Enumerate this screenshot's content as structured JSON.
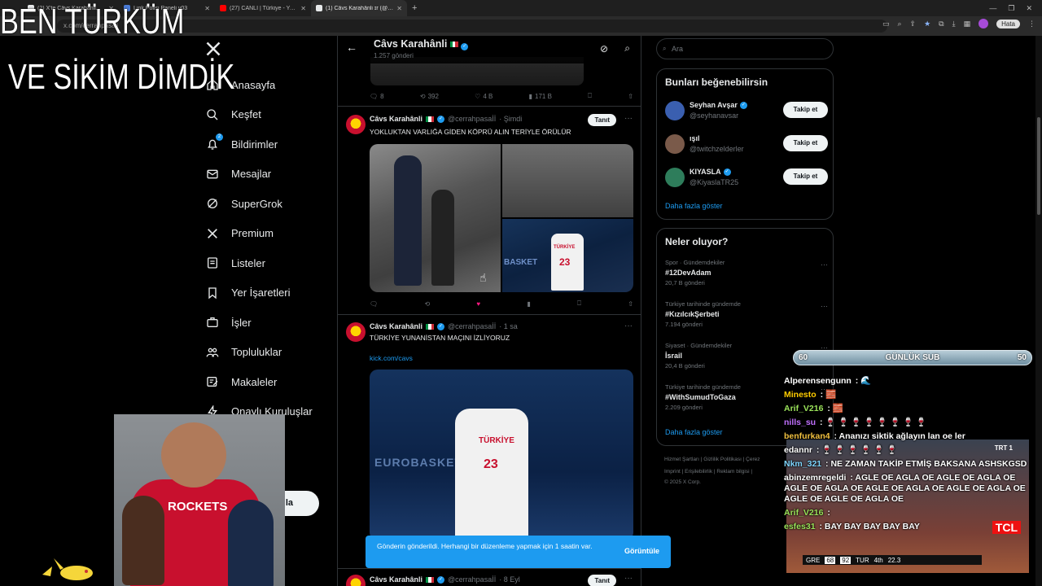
{
  "browser": {
    "tabs": [
      {
        "title": "(2) X'te Câvs Karahânli...",
        "color": "#e7e9ea",
        "active": false
      },
      {
        "title": "Link Polisi Paneli v03",
        "color": "#4a7bd6",
        "active": false
      },
      {
        "title": "(27) CANLI | Türkiye - Yunan",
        "color": "#ff0000",
        "active": false
      },
      {
        "title": "(1) Câvs Karahânli ɪr (@cerrah",
        "color": "#e7e9ea",
        "active": true
      }
    ],
    "url": "x.com/cerrahpasaii",
    "error_label": "Hata"
  },
  "sidebar": {
    "items": [
      {
        "label": "Anasayfa",
        "icon": "home-icon"
      },
      {
        "label": "Keşfet",
        "icon": "search-icon"
      },
      {
        "label": "Bildirimler",
        "icon": "bell-icon",
        "badge": "2"
      },
      {
        "label": "Mesajlar",
        "icon": "mail-icon"
      },
      {
        "label": "SuperGrok",
        "icon": "grok-icon"
      },
      {
        "label": "Premium",
        "icon": "x-icon"
      },
      {
        "label": "Listeler",
        "icon": "list-icon"
      },
      {
        "label": "Yer İşaretleri",
        "icon": "bookmark-icon"
      },
      {
        "label": "İşler",
        "icon": "briefcase-icon"
      },
      {
        "label": "Topluluklar",
        "icon": "people-icon"
      },
      {
        "label": "Makaleler",
        "icon": "article-icon"
      },
      {
        "label": "Onaylı Kuruluşlar",
        "icon": "lightning-icon"
      }
    ],
    "post_button": "la"
  },
  "profile_header": {
    "name": "Câvs Karahânli",
    "post_count": "1.257 gönderi"
  },
  "prev_tweet_actions": {
    "replies": "8",
    "reposts": "392",
    "likes": "4 B",
    "views": "171 B"
  },
  "tweets": [
    {
      "name": "Câvs Karahânli",
      "handle": "@cerrahpasaİİ",
      "time": "· Şimdi",
      "text": "YOKLUKTAN VARLIĞA GİDEN KÖPRÜ ALIN TERİYLE ÖRÜLÜR",
      "follow": "Tanıt",
      "media_labels": {
        "team": "TÜRKİYE",
        "number": "23",
        "court": "BASKET"
      }
    },
    {
      "name": "Câvs Karahânli",
      "handle": "@cerrahpasaİİ",
      "time": "· 1 sa",
      "text": "TÜRKİYE YUNANİSTAN MAÇINI İZLİYORUZ",
      "link": "kick.com/cavs",
      "media_labels": {
        "team": "TÜRKİYE",
        "number": "23",
        "court": "EUROBASKET"
      }
    },
    {
      "name": "Câvs Karahânli",
      "handle": "@cerrahpasaİİ",
      "time": "· 8 Eyl",
      "follow": "Tanıt"
    }
  ],
  "toast": {
    "text": "Gönderin gönderildi. Herhangi bir düzenleme yapmak için 1 saatin var.",
    "button": "Görüntüle"
  },
  "right": {
    "search_placeholder": "Ara",
    "suggest_title": "Bunları beğenebilirsin",
    "suggestions": [
      {
        "name": "Seyhan Avşar",
        "handle": "@seyhanavsar",
        "verified": true,
        "follow": "Takip et",
        "avatar_color": "#3a5fb0"
      },
      {
        "name": "ışıl",
        "handle": "@twitchzelderler",
        "verified": false,
        "follow": "Takip et",
        "avatar_color": "#7a5a4a"
      },
      {
        "name": "KIYASLA",
        "handle": "@KiyaslaTR25",
        "verified": true,
        "follow": "Takip et",
        "avatar_color": "#2e7d5b"
      }
    ],
    "show_more": "Daha fazla göster",
    "trends_title": "Neler oluyor?",
    "trends": [
      {
        "category": "Spor · Gündemdekiler",
        "tag": "#12DevAdam",
        "count": "20,7 B gönderi"
      },
      {
        "category": "Türkiye tarihinde gündemde",
        "tag": "#KızılcıkŞerbeti",
        "count": "7.194 gönderi"
      },
      {
        "category": "Siyaset · Gündemdekiler",
        "tag": "İsrail",
        "count": "20,4 B gönderi"
      },
      {
        "category": "Türkiye tarihinde gündemde",
        "tag": "#WithSumudToGaza",
        "count": "2.209 gönderi"
      }
    ],
    "footer_line1": "Hizmet Şartları  |  Gizlilik Politikası  |  Çerez",
    "footer_line2": "Imprint  |  Erişilebilirlik  |  Reklam bilgisi  |",
    "footer_line3": "© 2025 X Corp."
  },
  "overlay": {
    "line1": "BEN TÜRKÜM",
    "line2": "VE SİKİM DİMDİK",
    "sub_left": "60",
    "sub_label": "GÜNLÜK SUB",
    "sub_right": "50",
    "tv_channel": "TRT 1",
    "tv_brand": "TCL",
    "tv_score": {
      "home": "GRE",
      "home_pts": "68",
      "away_pts": "92",
      "away": "TUR",
      "quarter": "4th",
      "clock": "22.3"
    }
  },
  "chat": [
    {
      "user": "Alperensengunn",
      "color": "#ffffff",
      "msg": " 🌊"
    },
    {
      "user": "Minesto",
      "color": "#ffcc00",
      "msg": " 🧱"
    },
    {
      "user": "Arif_V216",
      "color": "#9be35a",
      "msg": " 🧱"
    },
    {
      "user": "nills_su",
      "color": "#c070ff",
      "msg": " 🍷 🍷 🍷 🍷 🍷 🍷 🍷 🍷"
    },
    {
      "user": "benfurkan4",
      "color": "#f0c040",
      "msg": " Ananızı siktik ağlayın lan oe ler"
    },
    {
      "user": "edannr",
      "color": "#ffffff",
      "msg": " 🍷 🍷 🍷 🍷 🍷 🍷"
    },
    {
      "user": "Nkm_321",
      "color": "#7fd6ff",
      "msg": " NE ZAMAN TAKİP ETMİŞ BAKSANA ASHSKGSD"
    },
    {
      "user": "abinzemregeldi",
      "color": "#ffffff",
      "msg": " AGLE OE AGLA OE AGLE OE AGLA OE AGLE OE AGLA OE AGLE OE AGLA OE AGLE OE AGLA OE AGLE OE AGLE OE AGLA OE"
    },
    {
      "user": "Arif_V216",
      "color": "#9be35a",
      "msg": ""
    },
    {
      "user": "esfes31",
      "color": "#9be35a",
      "msg": " BAY BAY BAY BAY BAY"
    }
  ]
}
